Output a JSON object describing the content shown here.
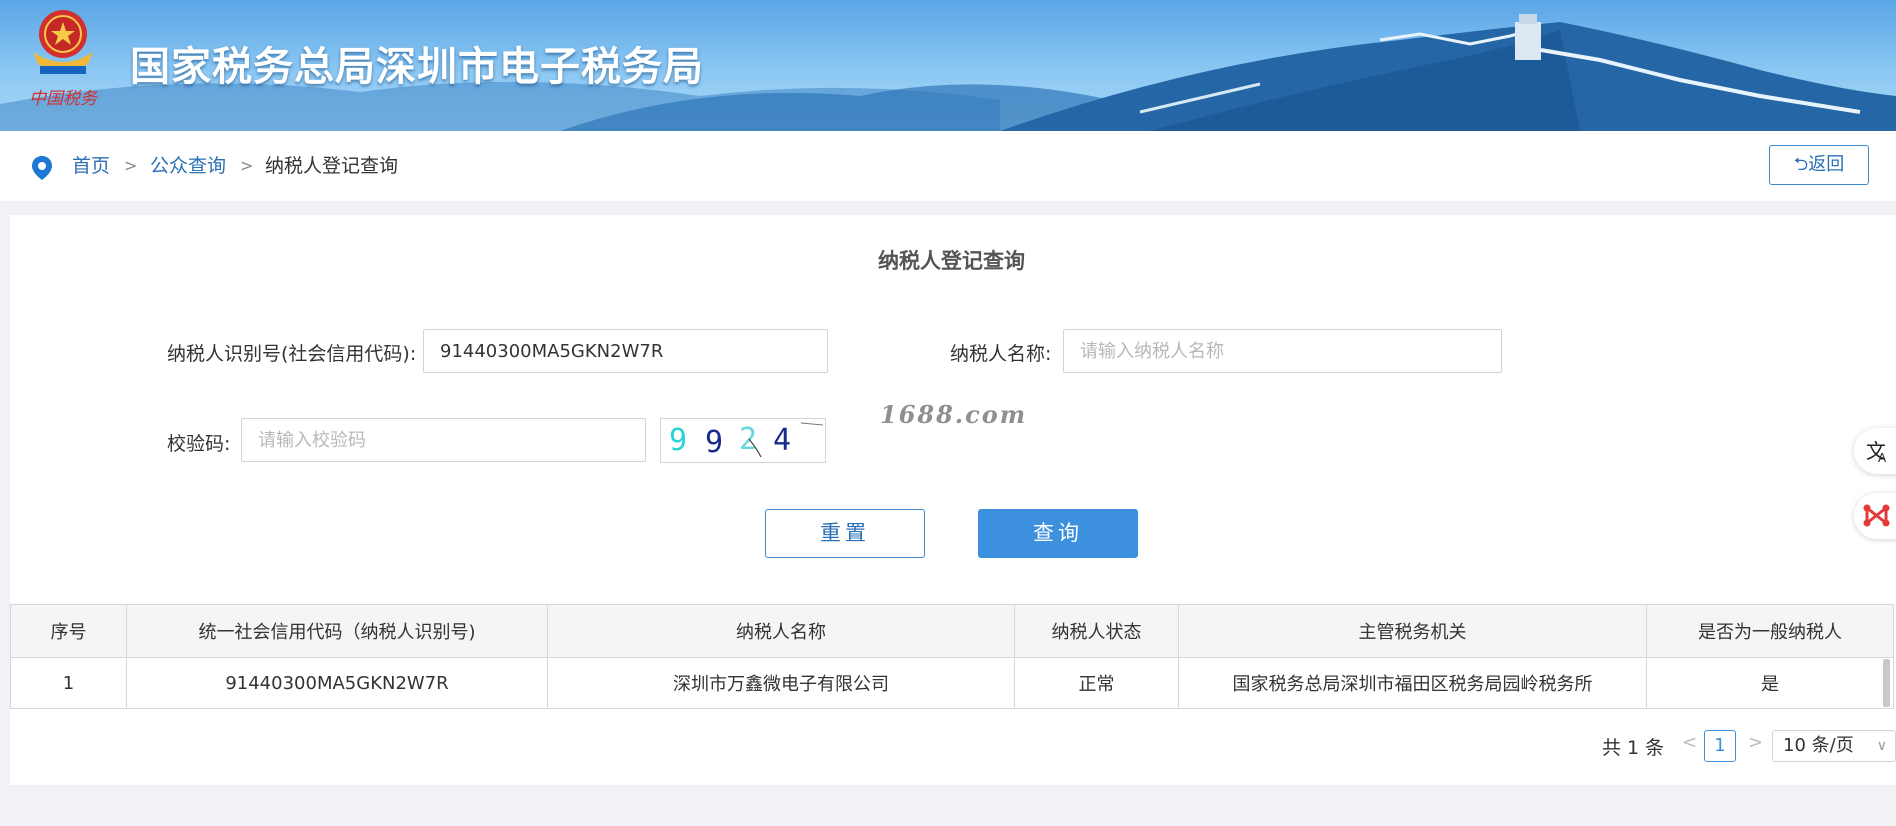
{
  "banner": {
    "title": "国家税务总局深圳市电子税务局",
    "emblem_caption": "中国税务"
  },
  "breadcrumb": {
    "home": "首页",
    "public_query": "公众查询",
    "current": "纳税人登记查询",
    "separator": ">"
  },
  "back_button": {
    "label": "⮌返回"
  },
  "form": {
    "title": "纳税人登记查询",
    "taxpayer_id_label": "纳税人识别号(社会信用代码):",
    "taxpayer_id_value": "91440300MA5GKN2W7R",
    "taxpayer_name_label": "纳税人名称:",
    "taxpayer_name_placeholder": "请输入纳税人名称",
    "captcha_label": "校验码:",
    "captcha_placeholder": "请输入校验码",
    "captcha_image_text": "9924",
    "reset_label": "重置",
    "query_label": "查询"
  },
  "watermark": "1688.com",
  "table": {
    "columns": [
      "序号",
      "统一社会信用代码（纳税人识别号)",
      "纳税人名称",
      "纳税人状态",
      "主管税务机关",
      "是否为一般纳税人"
    ],
    "rows": [
      [
        "1",
        "91440300MA5GKN2W7R",
        "深圳市万鑫微电子有限公司",
        "正常",
        "国家税务总局深圳市福田区税务局园岭税务所",
        "是"
      ]
    ]
  },
  "pagination": {
    "total": "共 1 条",
    "prev": "<",
    "current_page": "1",
    "next": ">",
    "page_size": "10 条/页"
  },
  "colors": {
    "primary": "#3d90dd",
    "link": "#2b6fb6",
    "banner_sky": "#8cc8f3"
  }
}
